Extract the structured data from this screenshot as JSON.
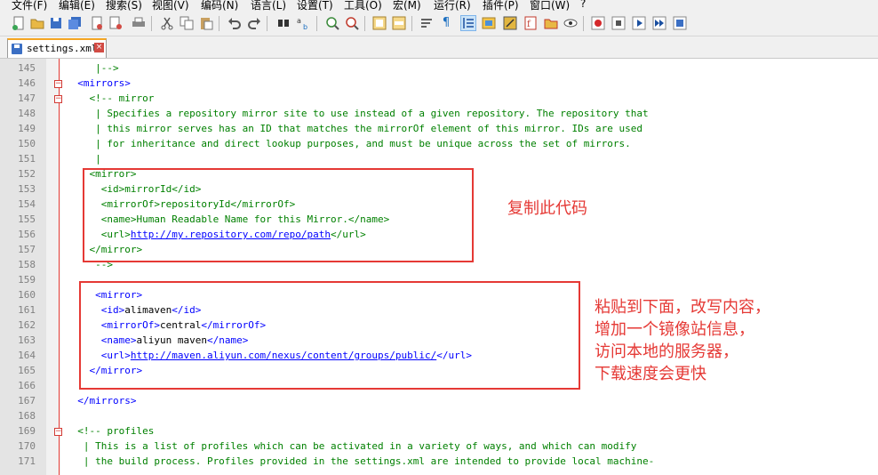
{
  "menu": [
    "文件(F)",
    "编辑(E)",
    "搜索(S)",
    "视图(V)",
    "编码(N)",
    "语言(L)",
    "设置(T)",
    "工具(O)",
    "宏(M)",
    "运行(R)",
    "插件(P)",
    "窗口(W)",
    "?"
  ],
  "toolbar_icons": [
    "new-file",
    "open-file",
    "save",
    "save-all",
    "close",
    "close-all",
    "print",
    "cut",
    "copy",
    "paste",
    "undo",
    "redo",
    "find",
    "replace",
    "zoom-in",
    "zoom-out",
    "sync-vertical",
    "sync-horizontal",
    "word-wrap",
    "show-all-chars",
    "indent-guide",
    "language-udl",
    "document-map",
    "function-list",
    "folder-workspace",
    "monitoring",
    "record-macro",
    "stop-macro",
    "play-macro",
    "run-macro-multiple"
  ],
  "tab": {
    "filename": "settings.xml",
    "close": "×"
  },
  "lines": [
    {
      "num": "145",
      "tokens": [
        {
          "t": "     |-->",
          "c": "cm"
        }
      ]
    },
    {
      "num": "146",
      "tokens": [
        {
          "t": "  <mirrors>",
          "c": "tg"
        }
      ]
    },
    {
      "num": "147",
      "tokens": [
        {
          "t": "    <!-- mirror",
          "c": "cm"
        }
      ]
    },
    {
      "num": "148",
      "tokens": [
        {
          "t": "     | Specifies a repository mirror site to use instead of a given repository. The repository that",
          "c": "cm"
        }
      ]
    },
    {
      "num": "149",
      "tokens": [
        {
          "t": "     | this mirror serves has an ID that matches the mirrorOf element of this mirror. IDs are used",
          "c": "cm"
        }
      ]
    },
    {
      "num": "150",
      "tokens": [
        {
          "t": "     | for inheritance and direct lookup purposes, and must be unique across the set of mirrors.",
          "c": "cm"
        }
      ]
    },
    {
      "num": "151",
      "tokens": [
        {
          "t": "     |",
          "c": "cm"
        }
      ]
    },
    {
      "num": "152",
      "tokens": [
        {
          "t": "    <mirror>",
          "c": "cm"
        }
      ]
    },
    {
      "num": "153",
      "tokens": [
        {
          "t": "      <id>mirrorId</id>",
          "c": "cm"
        }
      ]
    },
    {
      "num": "154",
      "tokens": [
        {
          "t": "      <mirrorOf>repositoryId</mirrorOf>",
          "c": "cm"
        }
      ]
    },
    {
      "num": "155",
      "tokens": [
        {
          "t": "      <name>Human Readable Name for this Mirror.</name>",
          "c": "cm"
        }
      ]
    },
    {
      "num": "156",
      "tokens": [
        {
          "t": "      <url>",
          "c": "cm"
        },
        {
          "t": "http://my.repository.com/repo/path",
          "c": "lk"
        },
        {
          "t": "</url>",
          "c": "cm"
        }
      ]
    },
    {
      "num": "157",
      "tokens": [
        {
          "t": "    </mirror>",
          "c": "cm"
        }
      ]
    },
    {
      "num": "158",
      "tokens": [
        {
          "t": "     -->",
          "c": "cm"
        }
      ]
    },
    {
      "num": "159",
      "tokens": []
    },
    {
      "num": "160",
      "tokens": [
        {
          "t": "     <mirror>",
          "c": "tg"
        }
      ]
    },
    {
      "num": "161",
      "tokens": [
        {
          "t": "      <id>",
          "c": "tg"
        },
        {
          "t": "alimaven",
          "c": "tx"
        },
        {
          "t": "</id>",
          "c": "tg"
        }
      ]
    },
    {
      "num": "162",
      "tokens": [
        {
          "t": "      <mirrorOf>",
          "c": "tg"
        },
        {
          "t": "central",
          "c": "tx"
        },
        {
          "t": "</mirrorOf>",
          "c": "tg"
        }
      ]
    },
    {
      "num": "163",
      "tokens": [
        {
          "t": "      <name>",
          "c": "tg"
        },
        {
          "t": "aliyun maven",
          "c": "tx"
        },
        {
          "t": "</name>",
          "c": "tg"
        }
      ]
    },
    {
      "num": "164",
      "tokens": [
        {
          "t": "      <url>",
          "c": "tg"
        },
        {
          "t": "http://maven.aliyun.com/nexus/content/groups/public/",
          "c": "lk"
        },
        {
          "t": "</url>",
          "c": "tg"
        }
      ]
    },
    {
      "num": "165",
      "tokens": [
        {
          "t": "    </mirror>",
          "c": "tg"
        }
      ]
    },
    {
      "num": "166",
      "tokens": []
    },
    {
      "num": "167",
      "tokens": [
        {
          "t": "  </mirrors>",
          "c": "tg"
        }
      ]
    },
    {
      "num": "168",
      "tokens": []
    },
    {
      "num": "169",
      "tokens": [
        {
          "t": "  <!-- profiles",
          "c": "cm"
        }
      ]
    },
    {
      "num": "170",
      "tokens": [
        {
          "t": "   | This is a list of profiles which can be activated in a variety of ways, and which can modify",
          "c": "cm"
        }
      ]
    },
    {
      "num": "171",
      "tokens": [
        {
          "t": "   | the build process. Profiles provided in the settings.xml are intended to provide local machine-",
          "c": "cm"
        }
      ]
    }
  ],
  "annotations": {
    "copy_note": "复制此代码",
    "paste_note": [
      "粘贴到下面，改写内容，",
      "增加一个镜像站信息，",
      "访问本地的服务器，",
      "下载速度会更快"
    ]
  },
  "colors": {
    "comment": "#008000",
    "tag": "#0000ff",
    "text": "#000000",
    "annotation": "#e53935",
    "tab_accent": "#f5a623"
  }
}
